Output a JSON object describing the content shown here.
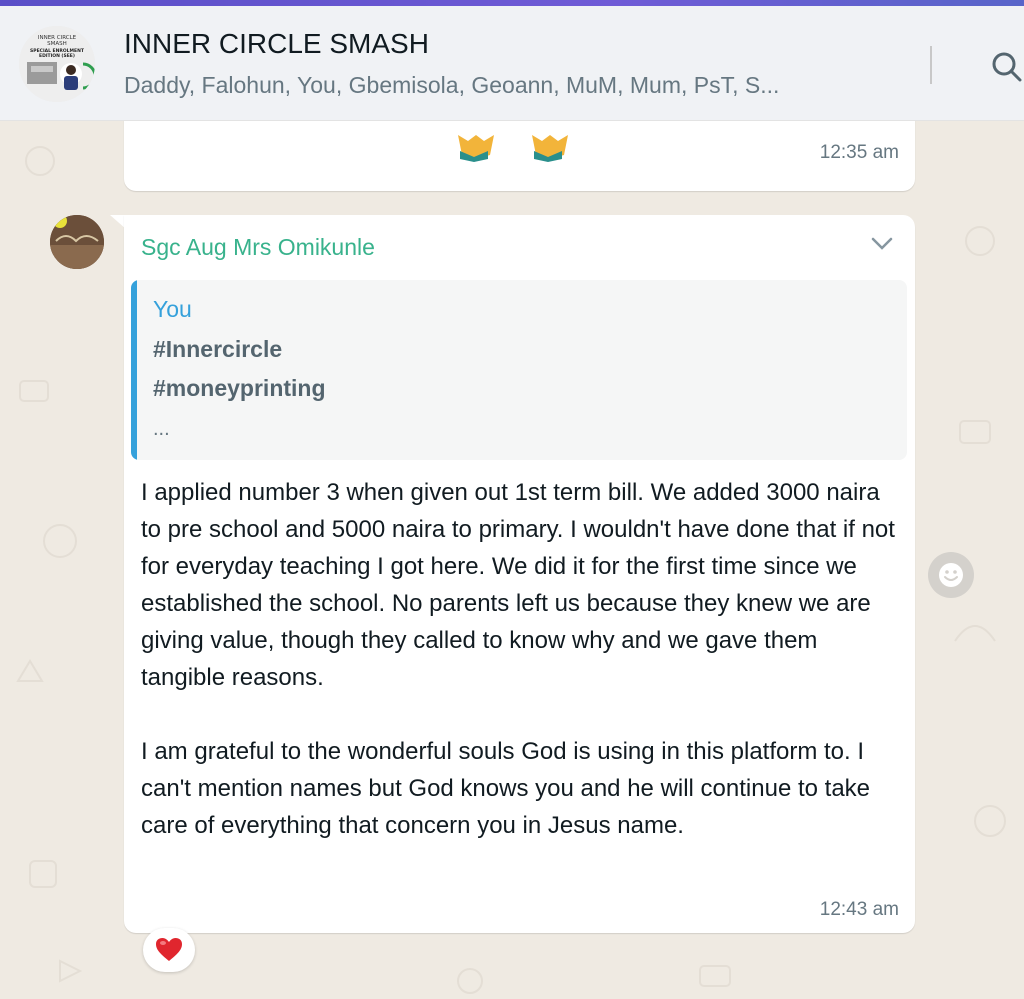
{
  "header": {
    "title": "INNER CIRCLE SMASH",
    "members": "Daddy, Falohun, You, Gbemisola, Geoann, MuM, Mum, PsT, S...",
    "avatar_text": [
      "INNER CIRCLE",
      "SMASH",
      "SPECIAL ENROLMENT",
      "EDITION (SEE)"
    ]
  },
  "messages": [
    {
      "content": "emoji",
      "emoji": [
        "folded-hands",
        "folded-hands"
      ],
      "time": "12:35 am"
    },
    {
      "sender": "Sgc Aug Mrs Omikunle",
      "quote": {
        "author": "You",
        "lines": [
          "#Innercircle",
          "#moneyprinting"
        ],
        "more": "..."
      },
      "text": "I applied number 3 when given out 1st term bill. We added 3000 naira to pre school and 5000 naira to primary. I wouldn't have done that if not for everyday teaching I got here. We did it for the first time since we established the school. No parents left us because they knew we are giving value, though they called to know why and we gave them tangible reasons.\n\nI am grateful to the wonderful souls God is using in this platform to. I can't mention names but God knows you and he will continue to take care of everything that concern you in Jesus name.",
      "time": "12:43 am",
      "reaction": "red-heart"
    }
  ],
  "colors": {
    "sender": "#38b28c",
    "quote_accent": "#35a1db",
    "wallpaper": "#efeae2",
    "header_bg": "#f0f2f5"
  },
  "icons": {
    "search": "search-icon",
    "chevron": "chevron-down-icon",
    "react": "smiley-icon",
    "reaction": "heart-icon"
  }
}
